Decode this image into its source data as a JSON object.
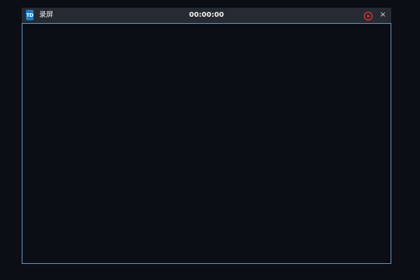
{
  "window": {
    "logo_text": "TD",
    "title": "录屏",
    "timer": "00:00:00",
    "close_label": "×"
  },
  "icons": {
    "logo": "app-logo-icon",
    "record": "record-play-icon",
    "close": "close-icon"
  },
  "colors": {
    "record_accent": "#e0312b",
    "capture_border": "#5d9fd8",
    "titlebar_bg": "#262a33",
    "logo_bg": "#1e7fc8"
  }
}
